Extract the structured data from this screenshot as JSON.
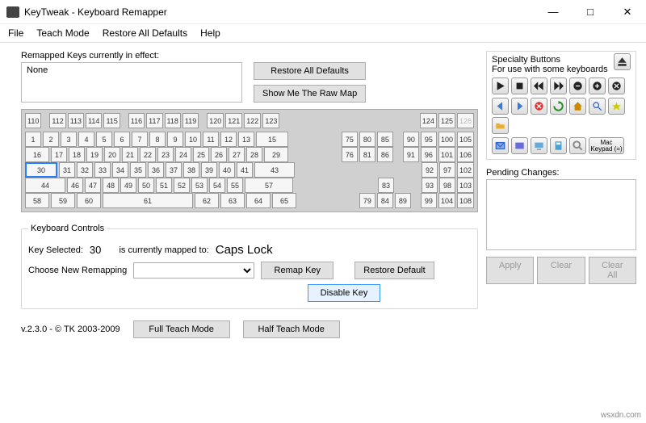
{
  "window": {
    "title": "KeyTweak -   Keyboard Remapper",
    "min": "—",
    "max": "□",
    "close": "✕"
  },
  "menu": {
    "file": "File",
    "teach": "Teach Mode",
    "restore": "Restore All Defaults",
    "help": "Help"
  },
  "remapped": {
    "label": "Remapped Keys currently in effect:",
    "list": "None",
    "restore_btn": "Restore All Defaults",
    "rawmap_btn": "Show Me The Raw Map"
  },
  "keyboard": {
    "selected_key": "30",
    "func_row_a": [
      "110",
      "",
      "112",
      "113",
      "114",
      "115",
      "",
      "116",
      "117",
      "118",
      "119",
      "",
      "120",
      "121",
      "122",
      "123"
    ],
    "func_nav": [
      "124",
      "125",
      "126"
    ],
    "row1": [
      "1",
      "2",
      "3",
      "4",
      "5",
      "6",
      "7",
      "8",
      "9",
      "10",
      "11",
      "12",
      "13",
      "15"
    ],
    "row1_nav": [
      "75",
      "80",
      "85"
    ],
    "row1_num": [
      "90",
      "95",
      "100",
      "105"
    ],
    "row2": [
      "16",
      "17",
      "18",
      "19",
      "20",
      "21",
      "22",
      "23",
      "24",
      "25",
      "26",
      "27",
      "28",
      "29"
    ],
    "row2_nav": [
      "76",
      "81",
      "86"
    ],
    "row2_num": [
      "91",
      "96",
      "101",
      "106"
    ],
    "row3": [
      "30",
      "31",
      "32",
      "33",
      "34",
      "35",
      "36",
      "37",
      "38",
      "39",
      "40",
      "41",
      "43"
    ],
    "row3_num": [
      "92",
      "97",
      "102"
    ],
    "row4": [
      "44",
      "46",
      "47",
      "48",
      "49",
      "50",
      "51",
      "52",
      "53",
      "54",
      "55",
      "57"
    ],
    "row4_nav": [
      "83"
    ],
    "row4_num": [
      "93",
      "98",
      "103"
    ],
    "row5": [
      "58",
      "59",
      "60",
      "61",
      "62",
      "63",
      "64",
      "65"
    ],
    "row5_nav": [
      "79",
      "84",
      "89"
    ],
    "row5_num": [
      "99",
      "104",
      "108"
    ]
  },
  "controls": {
    "legend": "Keyboard Controls",
    "key_selected_label": "Key Selected:",
    "key_selected_value": "30",
    "mapped_label": "is currently mapped to:",
    "mapped_value": "Caps Lock",
    "choose_label": "Choose New Remapping",
    "remap_btn": "Remap Key",
    "restore_btn": "Restore Default",
    "disable_btn": "Disable Key"
  },
  "specialty": {
    "title": "Specialty Buttons",
    "subtitle": "For use with some keyboards",
    "mac1": "Mac",
    "mac2": "Keypad (=)"
  },
  "pending": {
    "label": "Pending Changes:"
  },
  "footer": {
    "apply": "Apply",
    "clear": "Clear",
    "clear_all": "Clear All"
  },
  "bottom": {
    "version": "v.2.3.0 - © TK 2003-2009",
    "full_teach": "Full Teach Mode",
    "half_teach": "Half Teach Mode"
  },
  "watermark": "wsxdn.com"
}
